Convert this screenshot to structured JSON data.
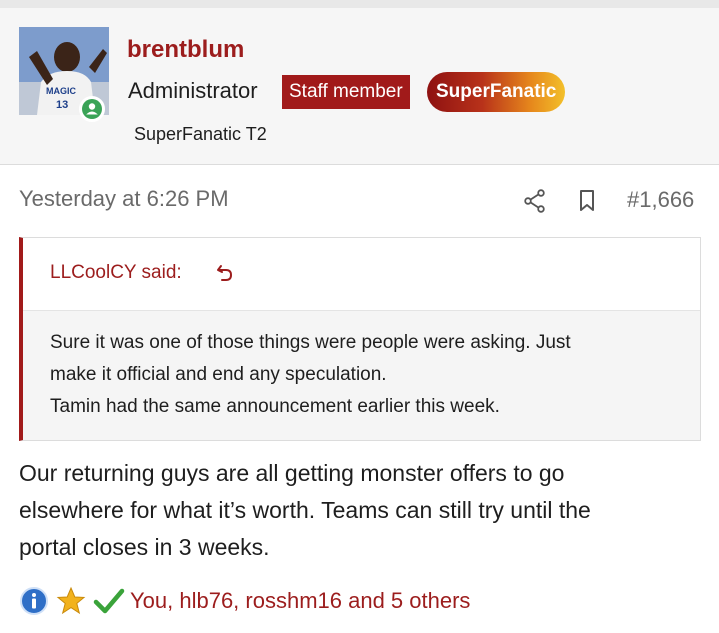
{
  "user": {
    "username": "brentblum",
    "role": "Administrator",
    "staff_badge": "Staff member",
    "fan_badge": "SuperFanatic",
    "user_title": "SuperFanatic T2",
    "avatar_jersey_text": "MAGIC",
    "avatar_jersey_number": "13",
    "online_status_color": "#3aa357"
  },
  "post": {
    "date": "Yesterday at 6:26 PM",
    "number": "#1,666",
    "quote": {
      "author": "LLCoolCY said:",
      "lines": [
        "Sure it was one of those things were people were asking. Just",
        "make it official and end any speculation.",
        "Tamin had the same announcement earlier this week."
      ]
    },
    "message_lines": [
      "Our returning guys are all getting monster offers to go",
      "elsewhere for what it’s worth. Teams can still try until the",
      "portal closes in 3 weeks."
    ],
    "reactions": {
      "icons": [
        "info-icon",
        "star-icon",
        "checkmark-icon"
      ],
      "summary": "You, hlb76, rosshm16 and 5 others"
    }
  },
  "colors": {
    "accent": "#a11a1a",
    "link": "#9c1d1d",
    "muted": "#6a6a6a"
  }
}
